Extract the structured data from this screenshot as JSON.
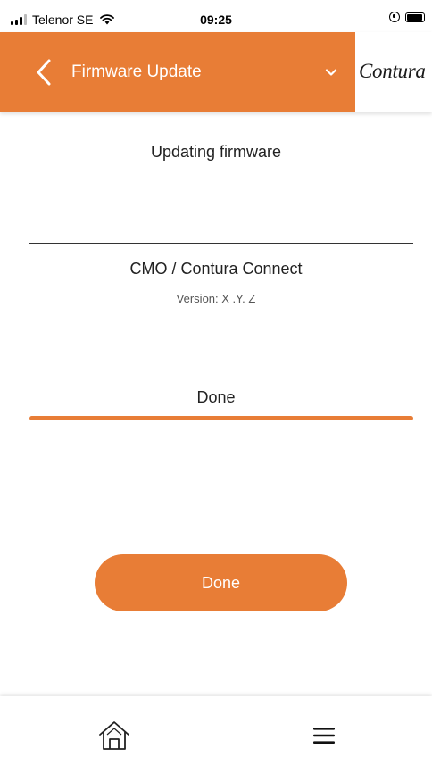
{
  "status_bar": {
    "carrier": "Telenor SE",
    "time": "09:25"
  },
  "header": {
    "title": "Firmware Update",
    "brand": "Contura",
    "accent_color": "#e87d36"
  },
  "main": {
    "title": "Updating firmware",
    "device": {
      "name": "CMO / Contura Connect",
      "version": "Version: X .Y. Z"
    },
    "progress": {
      "label": "Done",
      "fraction": 1.0
    },
    "done_button_label": "Done"
  },
  "bottom_nav": {
    "items": [
      {
        "icon": "home-icon"
      },
      {
        "icon": "menu-icon"
      }
    ]
  }
}
